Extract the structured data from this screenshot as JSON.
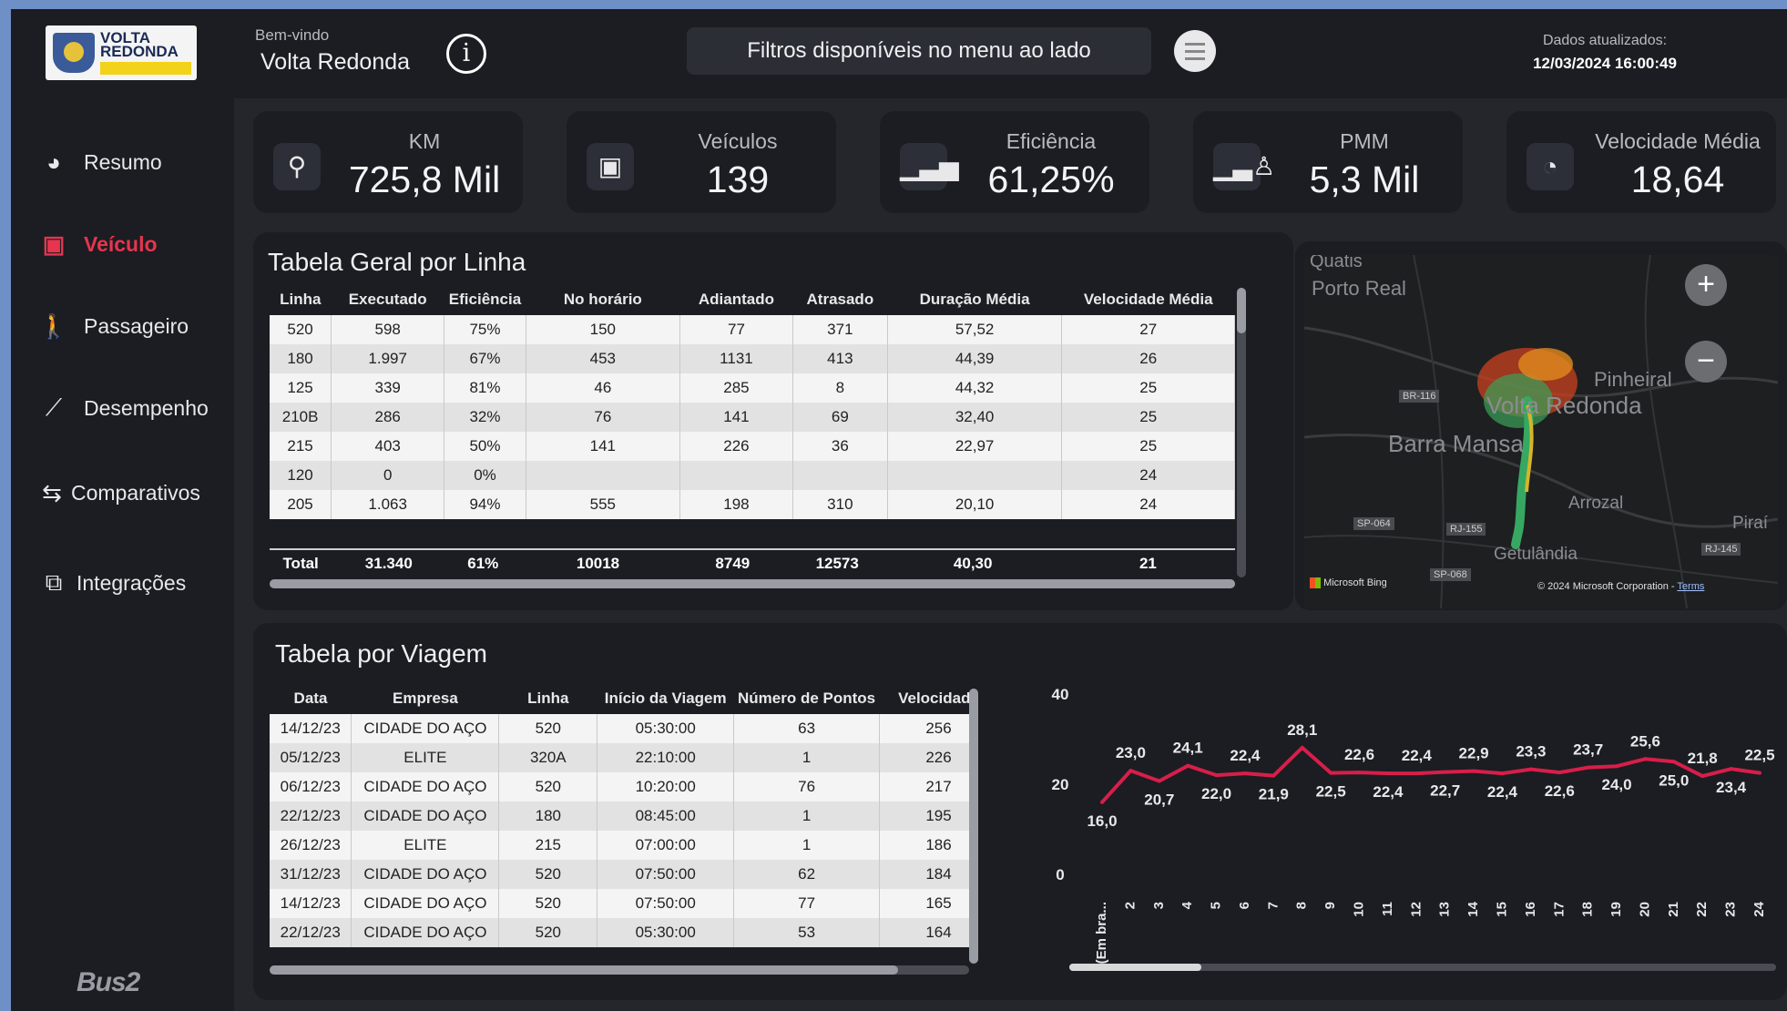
{
  "header": {
    "logo_text": "VOLTA REDONDA",
    "welcome_label": "Bem-vindo",
    "city": "Volta Redonda",
    "filters_text": "Filtros disponíveis no menu ao lado",
    "updated_label": "Dados atualizados:",
    "updated_value": "12/03/2024 16:00:49"
  },
  "sidebar": {
    "items": [
      {
        "label": "Resumo",
        "icon": "pie-chart-icon",
        "active": false
      },
      {
        "label": "Veículo",
        "icon": "bus-icon",
        "active": true
      },
      {
        "label": "Passageiro",
        "icon": "walking-person-icon",
        "active": false
      },
      {
        "label": "Desempenho",
        "icon": "line-chart-icon",
        "active": false
      },
      {
        "label": "Comparativos",
        "icon": "compare-icon",
        "active": false
      },
      {
        "label": "Integrações",
        "icon": "integration-icon",
        "active": false
      }
    ],
    "brand": "Bus2"
  },
  "kpis": [
    {
      "label": "KM",
      "value": "725,8 Mil",
      "icon": "map-pin-icon"
    },
    {
      "label": "Veículos",
      "value": "139",
      "icon": "bus-icon"
    },
    {
      "label": "Eficiência",
      "value": "61,25%",
      "icon": "signal-bars-icon"
    },
    {
      "label": "PMM",
      "value": "5,3 Mil",
      "icon": "person-bars-icon"
    },
    {
      "label": "Velocidade Média",
      "value": "18,64",
      "icon": "speedometer-icon"
    }
  ],
  "table_linha": {
    "title": "Tabela Geral por Linha",
    "columns": [
      "Linha",
      "Executado",
      "Eficiência",
      "No horário",
      "Adiantado",
      "Atrasado",
      "Duração Média",
      "Velocidade Média"
    ],
    "rows": [
      [
        "520",
        "598",
        "75%",
        "150",
        "77",
        "371",
        "57,52",
        "27"
      ],
      [
        "180",
        "1.997",
        "67%",
        "453",
        "1131",
        "413",
        "44,39",
        "26"
      ],
      [
        "125",
        "339",
        "81%",
        "46",
        "285",
        "8",
        "44,32",
        "25"
      ],
      [
        "210B",
        "286",
        "32%",
        "76",
        "141",
        "69",
        "32,40",
        "25"
      ],
      [
        "215",
        "403",
        "50%",
        "141",
        "226",
        "36",
        "22,97",
        "25"
      ],
      [
        "120",
        "0",
        "0%",
        "",
        "",
        "",
        "",
        "24"
      ],
      [
        "205",
        "1.063",
        "94%",
        "555",
        "198",
        "310",
        "20,10",
        "24"
      ]
    ],
    "total": [
      "Total",
      "31.340",
      "61%",
      "10018",
      "8749",
      "12573",
      "40,30",
      "21"
    ]
  },
  "map": {
    "labels": [
      "Quatis",
      "Porto Real",
      "Volta Redonda",
      "Pinheiral",
      "Barra Mansa",
      "Arrozal",
      "Piraí",
      "Getulândia"
    ],
    "road_labels": [
      "BR-116",
      "SP-064",
      "RJ-155",
      "SP-068",
      "RJ-145"
    ],
    "credit_left": "Microsoft Bing",
    "credit_right": "© 2024 Microsoft Corporation",
    "terms": "Terms"
  },
  "table_viagem": {
    "title": "Tabela por Viagem",
    "columns": [
      "Data",
      "Empresa",
      "Linha",
      "Início da Viagem",
      "Número de Pontos",
      "Velocidade"
    ],
    "rows": [
      [
        "14/12/23",
        "CIDADE DO AÇO",
        "520",
        "05:30:00",
        "63",
        "256"
      ],
      [
        "05/12/23",
        "ELITE",
        "320A",
        "22:10:00",
        "1",
        "226"
      ],
      [
        "06/12/23",
        "CIDADE DO AÇO",
        "520",
        "10:20:00",
        "76",
        "217"
      ],
      [
        "22/12/23",
        "CIDADE DO AÇO",
        "180",
        "08:45:00",
        "1",
        "195"
      ],
      [
        "26/12/23",
        "ELITE",
        "215",
        "07:00:00",
        "1",
        "186"
      ],
      [
        "31/12/23",
        "CIDADE DO AÇO",
        "520",
        "07:50:00",
        "62",
        "184"
      ],
      [
        "14/12/23",
        "CIDADE DO AÇO",
        "520",
        "07:50:00",
        "77",
        "165"
      ],
      [
        "22/12/23",
        "CIDADE DO AÇO",
        "520",
        "05:30:00",
        "53",
        "164"
      ]
    ]
  },
  "chart_data": {
    "type": "line",
    "x": [
      "(Em bra...",
      "2",
      "3",
      "4",
      "5",
      "6",
      "7",
      "8",
      "9",
      "10",
      "11",
      "12",
      "13",
      "14",
      "15",
      "16",
      "17",
      "18",
      "19",
      "20",
      "21",
      "22",
      "23",
      "24"
    ],
    "values": [
      16.0,
      23.0,
      20.7,
      24.1,
      22.0,
      22.4,
      21.9,
      28.1,
      22.5,
      22.6,
      22.4,
      22.4,
      22.7,
      22.9,
      22.4,
      23.3,
      22.6,
      23.7,
      24.0,
      25.6,
      25.0,
      21.8,
      23.4,
      22.5
    ],
    "labels": [
      "16,0",
      "23,0",
      "20,7",
      "24,1",
      "22,0",
      "22,4",
      "21,9",
      "28,1",
      "22,5",
      "22,6",
      "22,4",
      "22,4",
      "22,7",
      "22,9",
      "22,4",
      "23,3",
      "22,6",
      "23,7",
      "24,0",
      "25,6",
      "25,0",
      "21,8",
      "23,4",
      "22,5"
    ],
    "y_ticks": [
      "0",
      "20",
      "40"
    ],
    "ylim": [
      0,
      40
    ],
    "color": "#d81e4a"
  }
}
